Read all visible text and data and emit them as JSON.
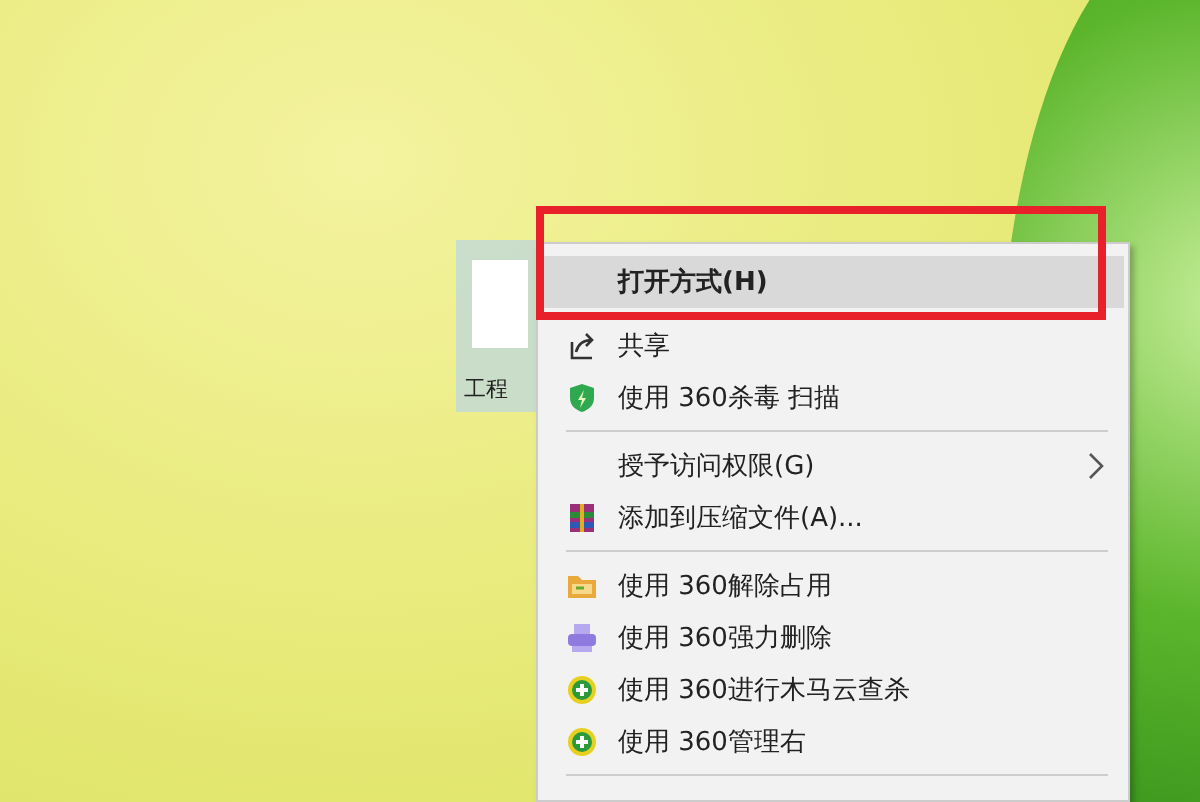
{
  "desktop_icon": {
    "label": "工程",
    "selected": true
  },
  "context_menu": {
    "items": [
      {
        "kind": "item",
        "label": "打开方式(H)",
        "bold": true,
        "selected": true,
        "submenu": false
      },
      {
        "kind": "item",
        "label": "共享",
        "bold": false,
        "selected": false,
        "submenu": false
      },
      {
        "kind": "item",
        "label": "使用 360杀毒 扫描",
        "bold": false,
        "selected": false,
        "submenu": false
      },
      {
        "kind": "separator"
      },
      {
        "kind": "item",
        "label": "授予访问权限(G)",
        "bold": false,
        "selected": false,
        "submenu": true
      },
      {
        "kind": "item",
        "label": "添加到压缩文件(A)...",
        "bold": false,
        "selected": false,
        "submenu": false
      },
      {
        "kind": "separator"
      },
      {
        "kind": "item",
        "label": "使用 360解除占用",
        "bold": false,
        "selected": false,
        "submenu": false
      },
      {
        "kind": "item",
        "label": "使用 360强力删除",
        "bold": false,
        "selected": false,
        "submenu": false
      },
      {
        "kind": "item",
        "label": "使用 360进行木马云查杀",
        "bold": false,
        "selected": false,
        "submenu": false
      },
      {
        "kind": "item",
        "label": "使用 360管理右",
        "bold": false,
        "selected": false,
        "submenu": false
      },
      {
        "kind": "separator"
      }
    ]
  },
  "annotation": {
    "kind": "highlight-rectangle"
  }
}
